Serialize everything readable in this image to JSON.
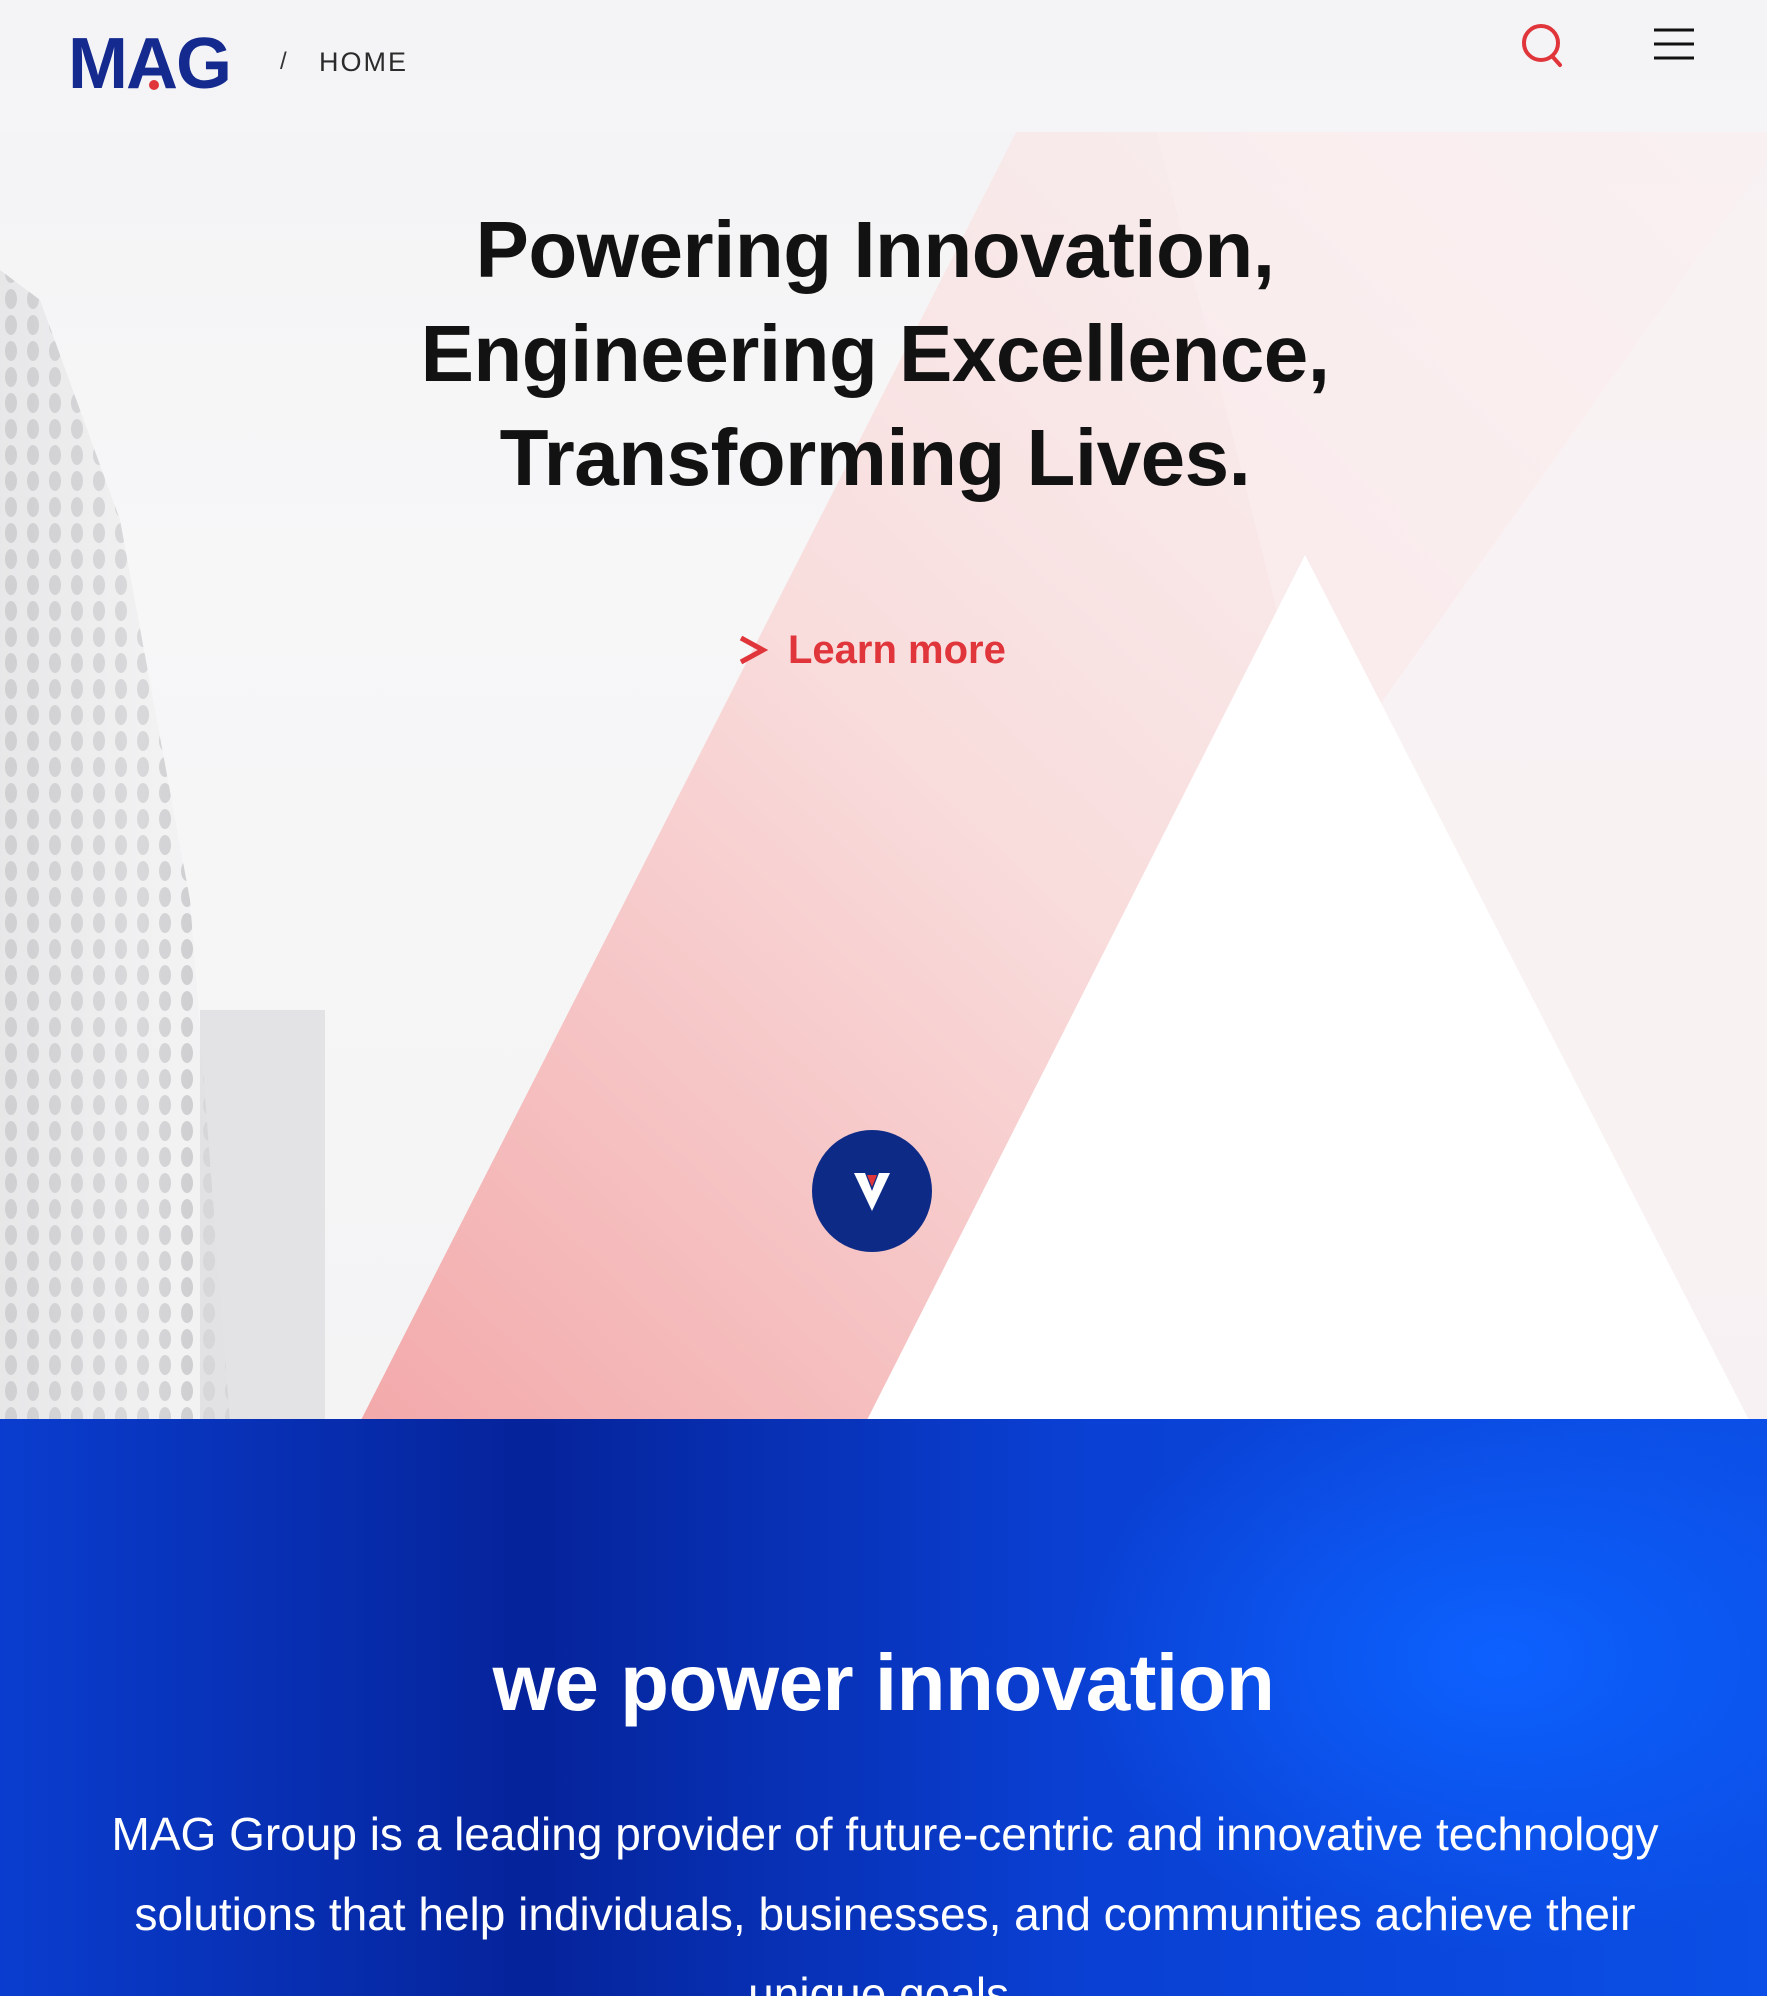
{
  "header": {
    "logo_text": "MAG",
    "breadcrumb_separator": "/",
    "breadcrumb_home": "HOME",
    "search_icon": "search-icon",
    "menu_icon": "hamburger-menu-icon"
  },
  "hero": {
    "headline_lines": [
      "Powering Innovation,",
      "Engineering Excellence,",
      "Transforming Lives."
    ],
    "cta_label": "Learn more",
    "cta_icon": "chevron-right-icon",
    "scroll_icon": "chevron-down-icon"
  },
  "about": {
    "title": "we power innovation",
    "body": "MAG Group is a leading provider of future-centric and innovative technology solutions that help individuals, businesses, and communities achieve their unique goals."
  },
  "colors": {
    "brand_blue": "#0d2b86",
    "accent_red": "#e0353a",
    "section_blue": "#0a3fd2"
  }
}
